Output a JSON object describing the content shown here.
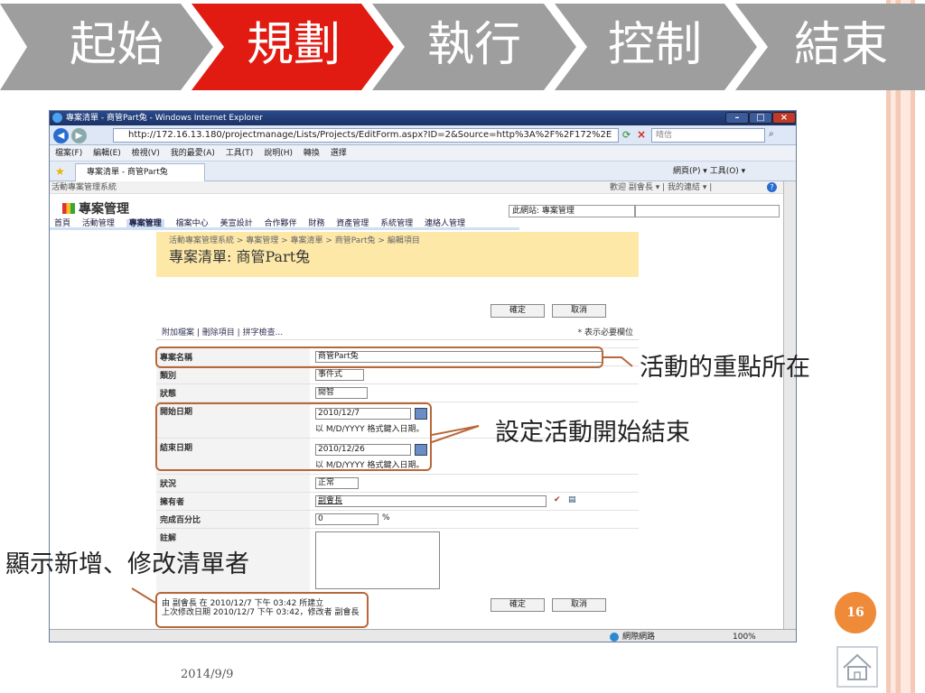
{
  "slide": {
    "steps": [
      {
        "label": "起始",
        "active": false
      },
      {
        "label": "規劃",
        "active": true
      },
      {
        "label": "執行",
        "active": false
      },
      {
        "label": "控制",
        "active": false
      },
      {
        "label": "結束",
        "active": false
      }
    ],
    "page_number": "16",
    "date": "2014/9/9",
    "colors": {
      "step_gray": "#9e9e9e",
      "step_active": "#e11b12",
      "accent_orange": "#ee8a38",
      "callout_brown": "#b7683a"
    },
    "annotations": {
      "focus": "活動的重點所在",
      "dates": "設定活動開始結束",
      "editor": "顯示新增、修改清單者"
    }
  },
  "browser": {
    "title": "專案清單 - 商管Part兔 - Windows Internet Explorer",
    "url": "http://172.16.13.180/projectmanage/Lists/Projects/EditForm.aspx?ID=2&Source=http%3A%2F%2F172%2E",
    "search_placeholder": "晴信",
    "menu": [
      "檔案(F)",
      "編輯(E)",
      "檢視(V)",
      "我的最愛(A)",
      "工具(T)",
      "說明(H)",
      "轉換",
      "選擇"
    ],
    "tab_label": "專案清單 - 商管Part兔",
    "toolbar_right": "網頁(P) ▾  工具(O) ▾",
    "status_zone": "網際網路",
    "zoom": "100%"
  },
  "sharepoint": {
    "top_left": "活動專案管理系統",
    "top_right": "歡迎 副會長 ▾ | 我的連結 ▾ |",
    "site_title": "專案管理",
    "site_scope": "此網站: 專案管理",
    "nav": [
      {
        "label": "首頁",
        "active": false
      },
      {
        "label": "活動管理",
        "active": false
      },
      {
        "label": "專案管理",
        "active": true
      },
      {
        "label": "檔案中心",
        "active": false
      },
      {
        "label": "美宣設計",
        "active": false
      },
      {
        "label": "合作夥伴",
        "active": false
      },
      {
        "label": "財務",
        "active": false
      },
      {
        "label": "資產管理",
        "active": false
      },
      {
        "label": "系統管理",
        "active": false
      },
      {
        "label": "連絡人管理",
        "active": false
      }
    ],
    "breadcrumb": "活動專案管理系統 > 專案管理 > 專案清單 > 商管Part兔 > 編輯項目",
    "page_title": "專案清單: 商管Part兔",
    "ok_label": "確定",
    "cancel_label": "取消",
    "tools": [
      "附加檔案",
      "刪除項目",
      "拼字檢查..."
    ],
    "required_note": "* 表示必要欄位",
    "fields": {
      "name": {
        "label": "專案名稱",
        "value": "商管Part兔"
      },
      "category": {
        "label": "類別",
        "value": "事件式"
      },
      "status": {
        "label": "狀態",
        "value": "開智"
      },
      "start": {
        "label": "開始日期",
        "value": "2010/12/7",
        "hint": "以 M/D/YYYY 格式鍵入日期。"
      },
      "end": {
        "label": "結束日期",
        "value": "2010/12/26",
        "hint": "以 M/D/YYYY 格式鍵入日期。"
      },
      "condition": {
        "label": "狀況",
        "value": "正常"
      },
      "owner": {
        "label": "擁有者",
        "value": "副會長"
      },
      "percent": {
        "label": "完成百分比",
        "value": "0",
        "unit": "%"
      },
      "notes": {
        "label": "註解",
        "value": ""
      }
    },
    "footer_created": "由 副會長   在 2010/12/7 下午 03:42 所建立",
    "footer_modified": "上次修改日期 2010/12/7 下午 03:42，修改者 副會長"
  }
}
